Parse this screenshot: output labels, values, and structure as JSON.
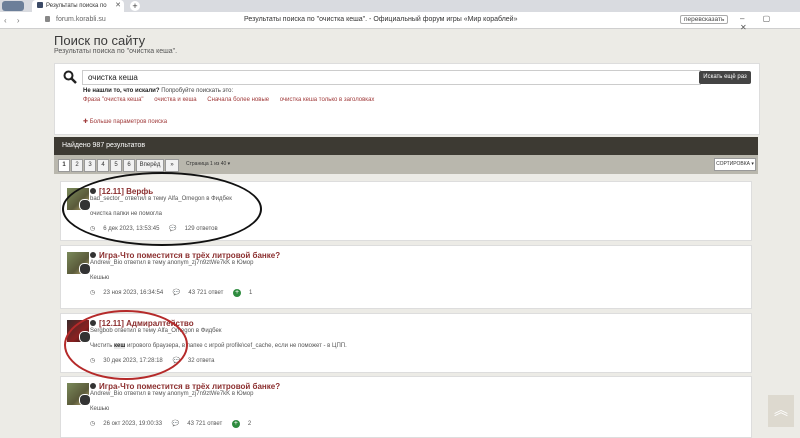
{
  "browser": {
    "tab_title": "Результаты поиска по",
    "url": "forum.korabli.su",
    "page_title": "Результаты поиска по \"очистка кеша\". - Официальный форум игры «Мир кораблей»",
    "translate_label": "перевсказать"
  },
  "header": {
    "title": "Поиск по сайту",
    "subtitle": "Результаты поиска по \"очистка кеша\"."
  },
  "search": {
    "query": "очистка кеша",
    "button": "Искать ещё раз",
    "notfound_bold": "Не нашли то, что искали?",
    "notfound_rest": " Попробуйте поискать это:",
    "suggestions": [
      "Фраза \"очистка кеша\"",
      "очистка и кеша",
      "Сначала более новые",
      "очистка кеша только в заголовках"
    ],
    "more_params": "✚ Больше параметров поиска"
  },
  "results": {
    "found": "Найдено 987 результатов",
    "pages": [
      "1",
      "2",
      "3",
      "4",
      "5",
      "6"
    ],
    "next": "Вперёд",
    "last": "»",
    "page_info": "Страница 1 из 40 ▾",
    "sort": "СОРТИРОВКА ▾"
  },
  "items": [
    {
      "title": "[12.11] Верфь",
      "meta": "bad_sector_ ответил в тему Alfa_Omegon в Фидбек",
      "snippet": "очистка папки не помогла",
      "date": "6 дек 2023, 13:53:45",
      "replies": "129 ответов",
      "rep": ""
    },
    {
      "title": "Игра-Что поместится в трёх литровой банке?",
      "meta": "Andrew_Bio ответил в тему anonym_zj7n9ztWe7kK в Юмор",
      "snippet": "Кешью",
      "date": "23 ноя 2023, 16:34:54",
      "replies": "43 721 ответ",
      "rep": "1"
    },
    {
      "title": "[12.11] Адмиралтейство",
      "meta": "Sergbob ответил в тему Alfa_Omegon в Фидбек",
      "snippet_pre": "Чистить ",
      "snippet_bold": "кеш",
      "snippet_post": " игрового браузера, в папке с игрой profile\\cef_cache, если не поможет - в ЦПП.",
      "date": "30 дек 2023, 17:28:18",
      "replies": "32 ответа",
      "rep": ""
    },
    {
      "title": "Игра-Что поместится в трёх литровой банке?",
      "meta": "Andrew_Bio ответил в тему anonym_zj7n9ztWe7kK в Юмор",
      "snippet": "Кешью",
      "date": "26 окт 2023, 19:00:33",
      "replies": "43 721 ответ",
      "rep": "2"
    }
  ]
}
